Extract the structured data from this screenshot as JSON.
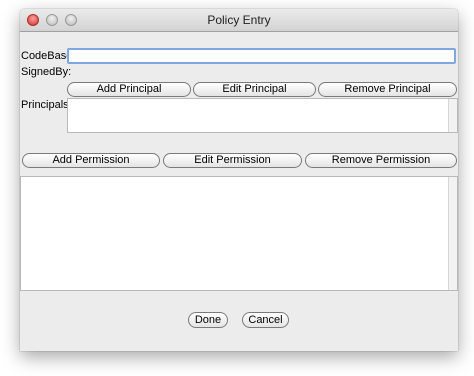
{
  "window": {
    "title": "Policy Entry"
  },
  "form": {
    "codebase_label": "CodeBase:",
    "codebase_value": "",
    "signedby_label": "SignedBy:",
    "principals_label": "Principals:"
  },
  "principal_buttons": {
    "add": "Add Principal",
    "edit": "Edit Principal",
    "remove": "Remove Principal"
  },
  "permission_buttons": {
    "add": "Add Permission",
    "edit": "Edit Permission",
    "remove": "Remove Permission"
  },
  "footer": {
    "done": "Done",
    "cancel": "Cancel"
  }
}
